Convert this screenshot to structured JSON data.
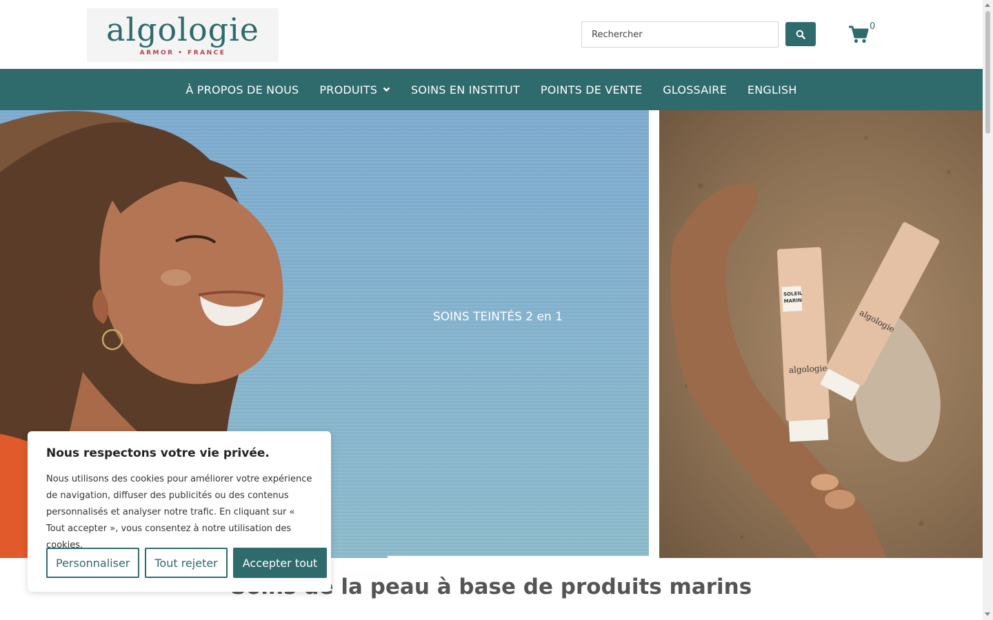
{
  "brand": {
    "logo_text": "algologie",
    "logo_subtitle": "ARMOR • FRANCE",
    "primary_color": "#2f6a6c",
    "accent_color": "#b0444a"
  },
  "header": {
    "search_placeholder": "Rechercher",
    "search_icon": "search-icon",
    "cart_icon": "shopping-cart-icon",
    "cart_count": "0"
  },
  "nav": {
    "items": [
      {
        "label": "À PROPOS DE NOUS",
        "has_dropdown": false
      },
      {
        "label": "PRODUITS",
        "has_dropdown": true
      },
      {
        "label": "SOINS EN INSTITUT",
        "has_dropdown": false
      },
      {
        "label": "POINTS DE VENTE",
        "has_dropdown": false
      },
      {
        "label": "GLOSSAIRE",
        "has_dropdown": false
      },
      {
        "label": "ENGLISH",
        "has_dropdown": false
      }
    ]
  },
  "hero": {
    "caption": "SOINS TEINTÉS 2 en 1",
    "tube_brand": "algologie",
    "tube_name": "SOLEIL MARIN"
  },
  "main": {
    "tagline": "Soins de la peau à base de produits marins"
  },
  "cookie_banner": {
    "title": "Nous respectons votre vie privée.",
    "text": "Nous utilisons des cookies pour améliorer votre expérience de navigation, diffuser des publicités ou des contenus personnalisés et analyser notre trafic. En cliquant sur « Tout accepter », vous consentez à notre utilisation des cookies.",
    "customize_label": "Personnaliser",
    "reject_label": "Tout rejeter",
    "accept_label": "Accepter tout"
  }
}
